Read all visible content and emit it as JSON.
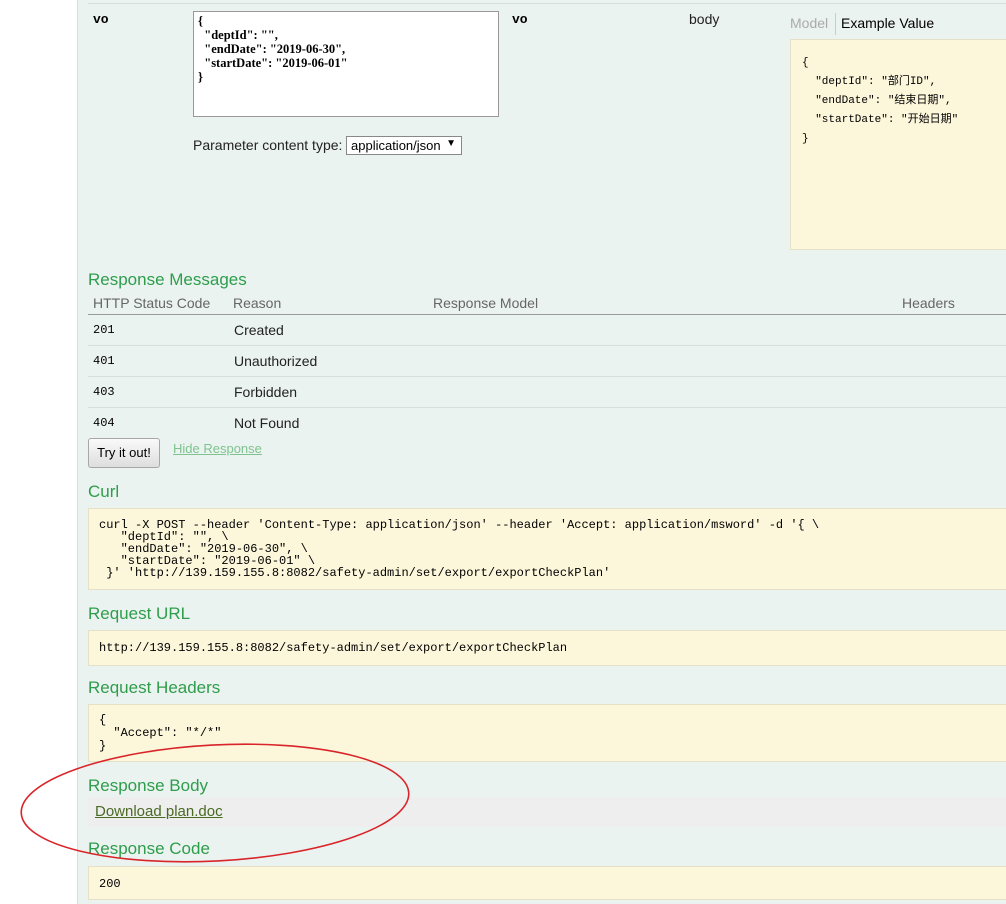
{
  "parameter": {
    "name": "vo",
    "value_lines": [
      "{",
      "  \"deptId\": \"\",",
      "  \"endDate\": \"2019-06-30\",",
      "  \"startDate\": \"2019-06-01\"",
      "}"
    ],
    "data_type": "vo",
    "param_type": "body",
    "content_type_label": "Parameter content type:",
    "content_type_value": "application/json",
    "model_tab": "Model",
    "example_tab": "Example Value",
    "example_lines": [
      "{",
      "  \"deptId\": \"部门ID\",",
      "  \"endDate\": \"结束日期\",",
      "  \"startDate\": \"开始日期\"",
      "}"
    ]
  },
  "response_messages": {
    "title": "Response Messages",
    "headers": [
      "HTTP Status Code",
      "Reason",
      "Response Model",
      "Headers"
    ],
    "rows": [
      {
        "code": "201",
        "reason": "Created"
      },
      {
        "code": "401",
        "reason": "Unauthorized"
      },
      {
        "code": "403",
        "reason": "Forbidden"
      },
      {
        "code": "404",
        "reason": "Not Found"
      }
    ]
  },
  "actions": {
    "try_label": "Try it out!",
    "hide_label": "Hide Response"
  },
  "curl": {
    "title": "Curl",
    "lines": [
      "curl -X POST --header 'Content-Type: application/json' --header 'Accept: application/msword' -d '{ \\",
      "   \"deptId\": \"\", \\",
      "   \"endDate\": \"2019-06-30\", \\",
      "   \"startDate\": \"2019-06-01\" \\",
      " }' 'http://139.159.155.8:8082/safety-admin/set/export/exportCheckPlan'"
    ]
  },
  "request_url": {
    "title": "Request URL",
    "value": "http://139.159.155.8:8082/safety-admin/set/export/exportCheckPlan"
  },
  "request_headers": {
    "title": "Request Headers",
    "lines": [
      "{",
      "  \"Accept\": \"*/*\"",
      "}"
    ]
  },
  "response_body": {
    "title": "Response Body",
    "download_label": "Download plan.doc"
  },
  "response_code": {
    "title": "Response Code",
    "value": "200"
  },
  "colors": {
    "accent_green": "#2e9d4c",
    "code_bg": "#fcf6db",
    "panel_bg": "#ebf3f0",
    "annotation_red": "#d9252a"
  }
}
